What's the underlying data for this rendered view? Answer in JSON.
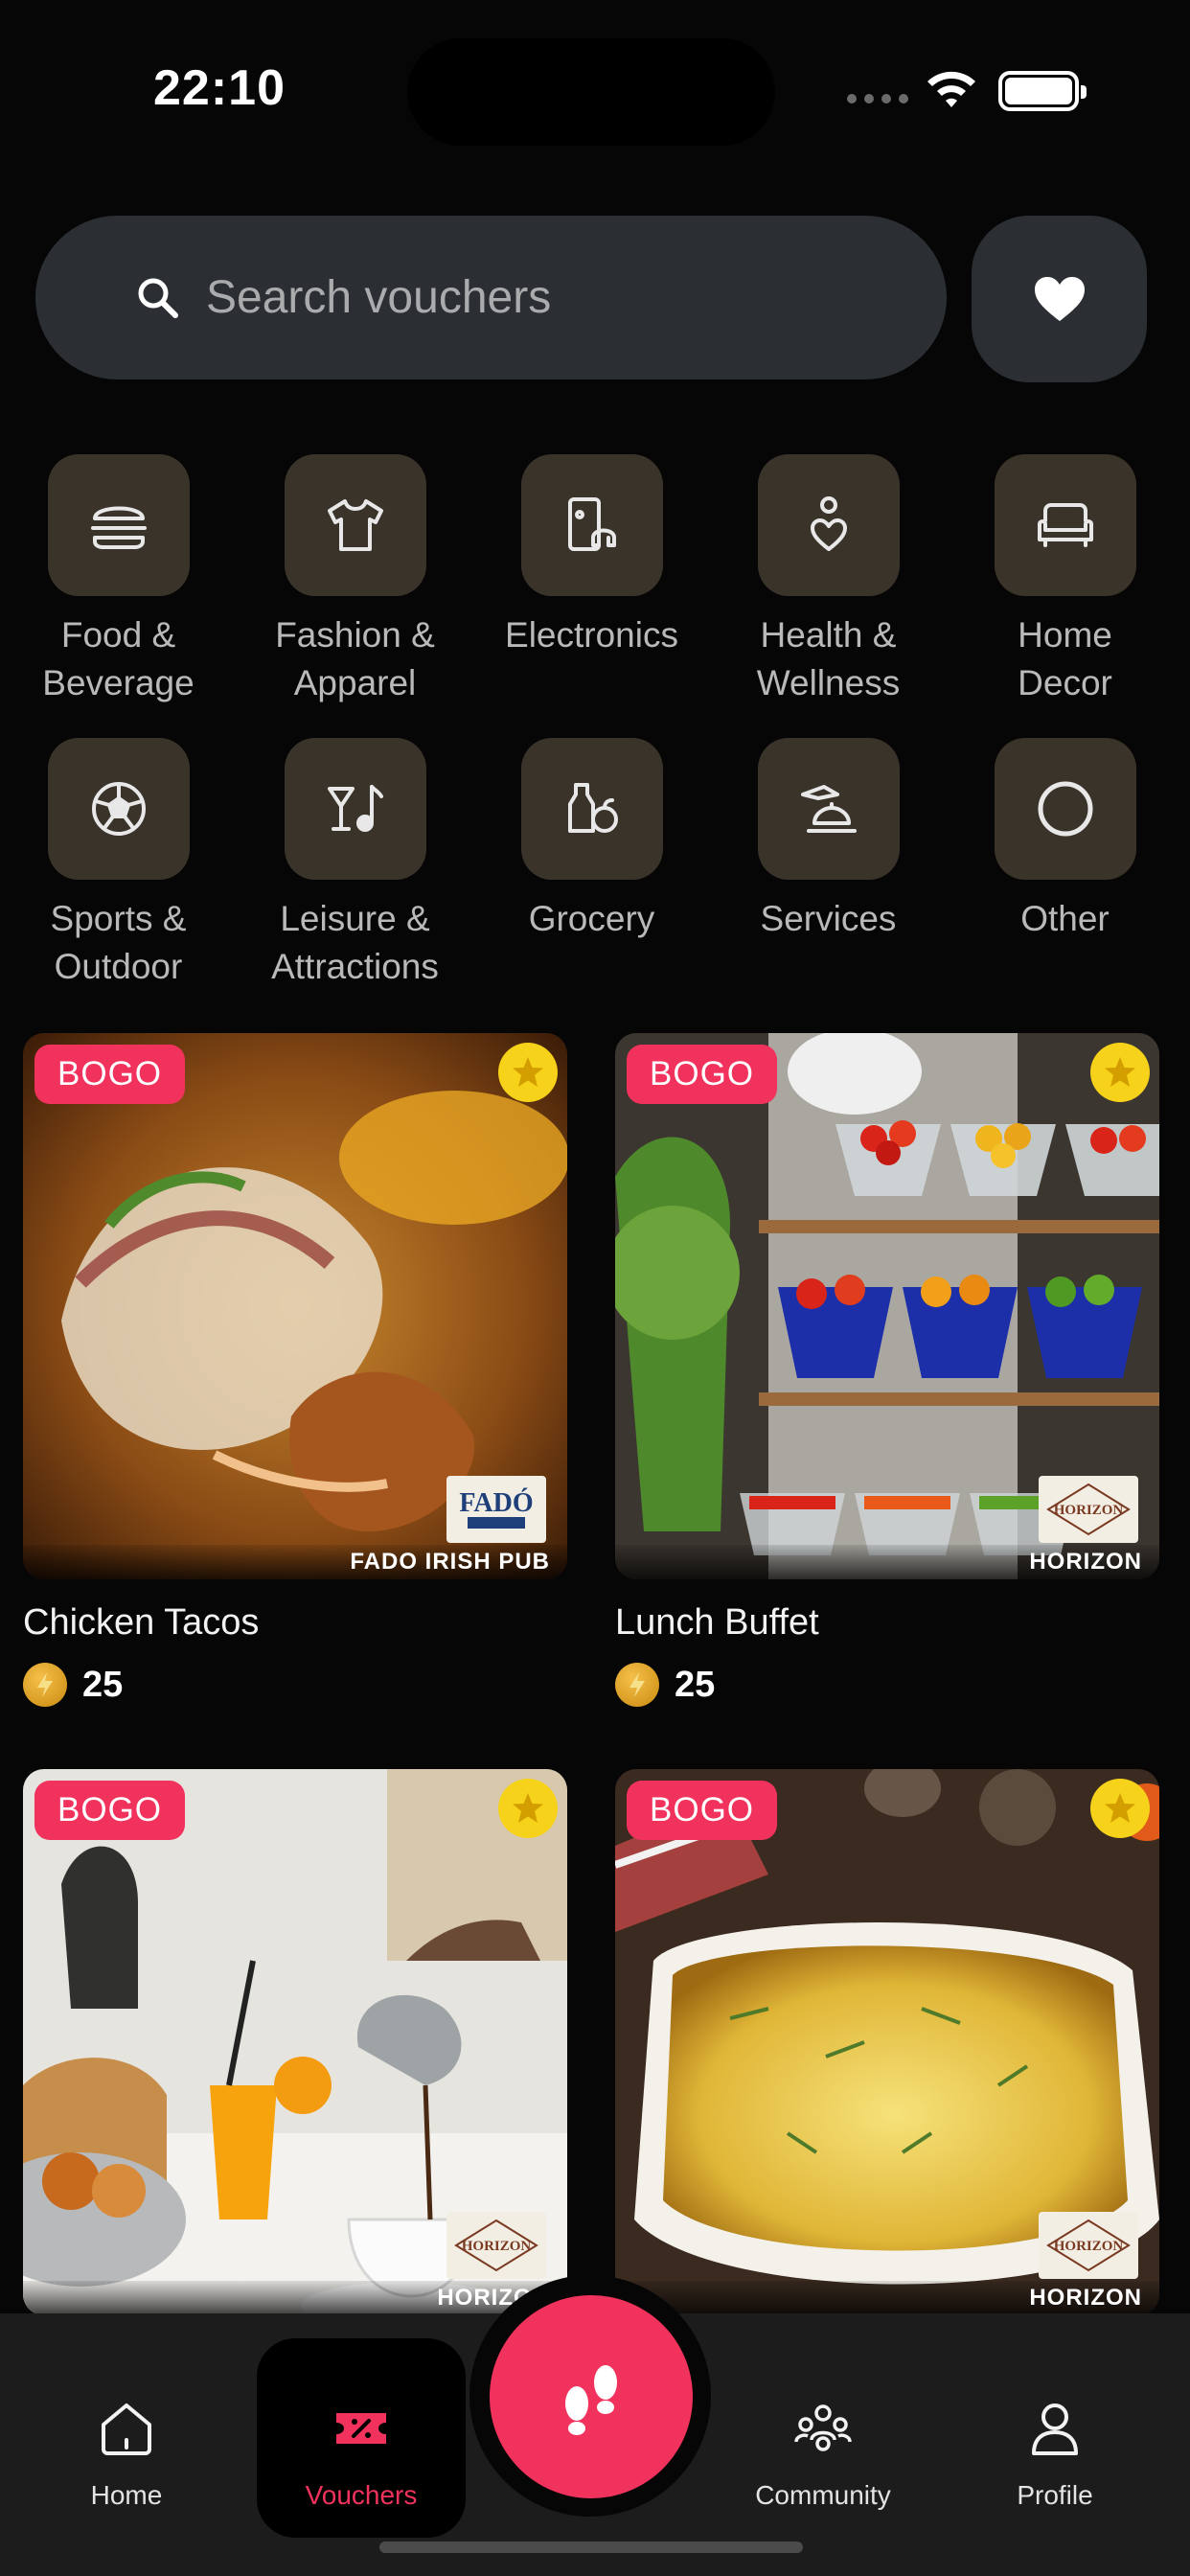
{
  "status_bar": {
    "time": "22:10"
  },
  "search": {
    "placeholder": "Search vouchers"
  },
  "categories": [
    {
      "label": "Food &\nBeverage",
      "icon": "burger-icon"
    },
    {
      "label": "Fashion &\nApparel",
      "icon": "tshirt-icon"
    },
    {
      "label": "Electronics",
      "icon": "devices-icon"
    },
    {
      "label": "Health &\nWellness",
      "icon": "wellness-icon"
    },
    {
      "label": "Home\nDecor",
      "icon": "sofa-icon"
    },
    {
      "label": "Sports &\nOutdoor",
      "icon": "soccer-ball-icon"
    },
    {
      "label": "Leisure &\nAttractions",
      "icon": "cocktail-music-icon"
    },
    {
      "label": "Grocery",
      "icon": "grocery-icon"
    },
    {
      "label": "Services",
      "icon": "service-bell-icon"
    },
    {
      "label": "Other",
      "icon": "circle-icon"
    }
  ],
  "vouchers": [
    {
      "badge": "BOGO",
      "title": "Chicken Tacos",
      "price": "25",
      "brand": "FADO IRISH PUB",
      "logo_text": "FADÓ",
      "image": "tacos-photo"
    },
    {
      "badge": "BOGO",
      "title": "Lunch Buffet",
      "price": "25",
      "brand": "HORIZON",
      "logo_text": "HORIZON",
      "image": "buffet-photo"
    },
    {
      "badge": "BOGO",
      "title": "",
      "price": "",
      "brand": "HORIZON",
      "logo_text": "HORIZON",
      "image": "breakfast-photo"
    },
    {
      "badge": "BOGO",
      "title": "",
      "price": "",
      "brand": "HORIZON",
      "logo_text": "HORIZON",
      "image": "shepherds-pie-photo"
    }
  ],
  "nav": {
    "home": "Home",
    "vouchers": "Vouchers",
    "community": "Community",
    "profile": "Profile"
  },
  "colors": {
    "accent": "#f0325c",
    "background": "#060606",
    "category_tile": "#3a332a",
    "search_bg": "#2b2f33",
    "star_badge": "#f7d21a"
  }
}
